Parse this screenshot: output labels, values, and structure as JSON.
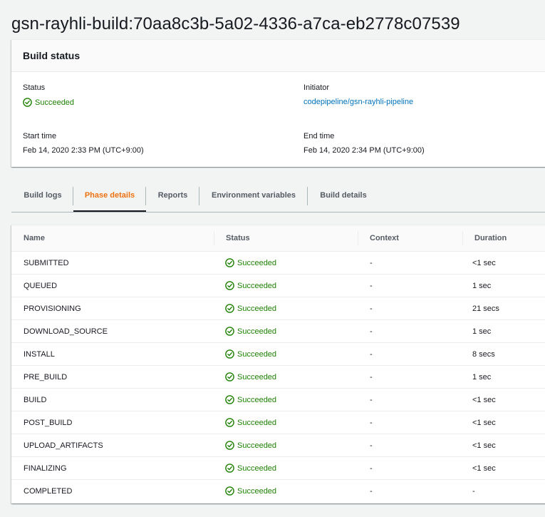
{
  "page": {
    "title": "gsn-rayhli-build:70aa8c3b-5a02-4336-a7ca-eb2778c07539"
  },
  "build_status": {
    "heading": "Build status",
    "status_label": "Status",
    "status_value": "Succeeded",
    "initiator_label": "Initiator",
    "initiator_value": "codepipeline/gsn-rayhli-pipeline",
    "start_label": "Start time",
    "start_value": "Feb 14, 2020 2:33 PM (UTC+9:00)",
    "end_label": "End time",
    "end_value": "Feb 14, 2020 2:34 PM (UTC+9:00)"
  },
  "tabs": {
    "build_logs": "Build logs",
    "phase_details": "Phase details",
    "reports": "Reports",
    "environment_variables": "Environment variables",
    "build_details": "Build details",
    "active": "phase_details"
  },
  "phase_table": {
    "columns": {
      "name": "Name",
      "status": "Status",
      "context": "Context",
      "duration": "Duration"
    },
    "rows": [
      {
        "name": "SUBMITTED",
        "status": "Succeeded",
        "context": "-",
        "duration": "<1 sec"
      },
      {
        "name": "QUEUED",
        "status": "Succeeded",
        "context": "-",
        "duration": "1 sec"
      },
      {
        "name": "PROVISIONING",
        "status": "Succeeded",
        "context": "-",
        "duration": "21 secs"
      },
      {
        "name": "DOWNLOAD_SOURCE",
        "status": "Succeeded",
        "context": "-",
        "duration": "1 sec"
      },
      {
        "name": "INSTALL",
        "status": "Succeeded",
        "context": "-",
        "duration": "8 secs"
      },
      {
        "name": "PRE_BUILD",
        "status": "Succeeded",
        "context": "-",
        "duration": "1 sec"
      },
      {
        "name": "BUILD",
        "status": "Succeeded",
        "context": "-",
        "duration": "<1 sec"
      },
      {
        "name": "POST_BUILD",
        "status": "Succeeded",
        "context": "-",
        "duration": "<1 sec"
      },
      {
        "name": "UPLOAD_ARTIFACTS",
        "status": "Succeeded",
        "context": "-",
        "duration": "<1 sec"
      },
      {
        "name": "FINALIZING",
        "status": "Succeeded",
        "context": "-",
        "duration": "<1 sec"
      },
      {
        "name": "COMPLETED",
        "status": "Succeeded",
        "context": "-",
        "duration": "-"
      }
    ]
  },
  "colors": {
    "success": "#1d8102",
    "link": "#0073bb",
    "active_tab": "#ec7211",
    "page_bg": "#f2f3f3"
  },
  "icons": {
    "status_icon": "check-circle-icon"
  }
}
